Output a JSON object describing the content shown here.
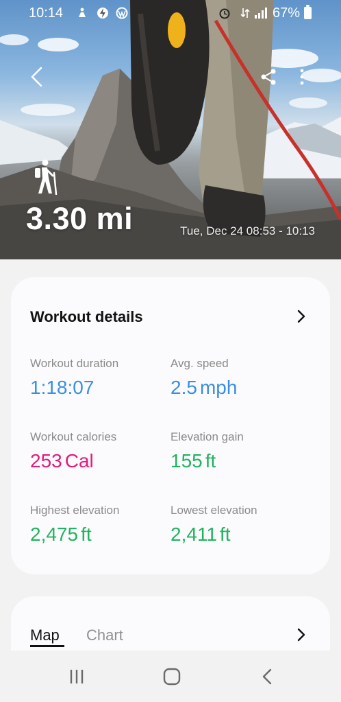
{
  "status_bar": {
    "time": "10:14",
    "battery": "67%",
    "icons": [
      "person-icon",
      "bolt-icon",
      "wordpress-icon",
      "alarm-icon",
      "data-icon",
      "signal-icon",
      "battery-icon"
    ]
  },
  "header": {
    "back_icon": "back-arrow-icon",
    "share_icon": "share-icon",
    "more_icon": "more-options-icon"
  },
  "workout": {
    "activity_icon": "hiking-icon",
    "distance": "3.30 mi",
    "date_range": "Tue, Dec 24 08:53 - 10:13"
  },
  "details": {
    "title": "Workout details",
    "colors": {
      "blue": "#3b8fe0",
      "pink": "#e5197d",
      "green": "#21b35e"
    },
    "metrics": [
      {
        "label": "Workout duration",
        "value": "1:18:07",
        "unit": ""
      },
      {
        "label": "Avg. speed",
        "value": "2.5",
        "unit": "mph"
      },
      {
        "label": "Workout calories",
        "value": "253",
        "unit": "Cal"
      },
      {
        "label": "Elevation gain",
        "value": "155",
        "unit": "ft"
      },
      {
        "label": "Highest elevation",
        "value": "2,475",
        "unit": "ft"
      },
      {
        "label": "Lowest elevation",
        "value": "2,411",
        "unit": "ft"
      }
    ]
  },
  "map_card": {
    "tabs": [
      {
        "label": "Map",
        "selected": true
      },
      {
        "label": "Chart",
        "selected": false
      }
    ]
  },
  "navigation": {
    "recents_icon": "recent-apps-icon",
    "home_icon": "home-icon",
    "back_icon": "nav-back-icon"
  }
}
